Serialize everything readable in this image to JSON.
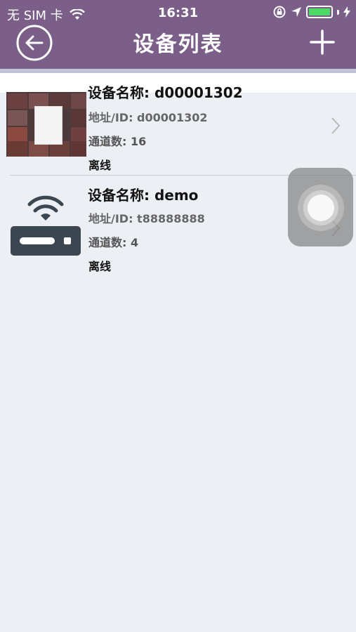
{
  "status_bar": {
    "carrier": "无 SIM 卡",
    "time": "16:31",
    "battery_level": 1.0
  },
  "nav": {
    "title": "设备列表",
    "back_icon": "back-arrow-icon",
    "add_icon": "plus-icon"
  },
  "devices": [
    {
      "name": "设备名称: d00001302",
      "address": "地址/ID: d00001302",
      "channels": "通道数: 16",
      "status": "离线",
      "icon": "camera-thumbnail"
    },
    {
      "name": "设备名称: demo",
      "address": "地址/ID: t88888888",
      "channels": "通道数: 4",
      "status": "离线",
      "icon": "router-icon"
    }
  ],
  "colors": {
    "nav_background": "#7b5f88",
    "list_background": "#eceff4",
    "battery": "#4cd964"
  }
}
